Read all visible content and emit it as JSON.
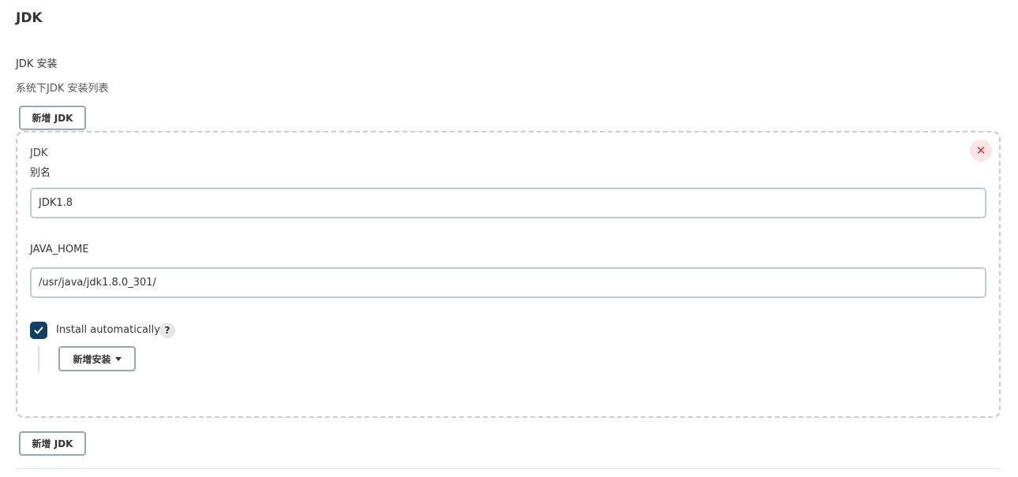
{
  "page": {
    "title": "JDK"
  },
  "section": {
    "label": "JDK 安装",
    "description": "系统下JDK 安装列表"
  },
  "buttons": {
    "add_jdk_top": "新增 JDK",
    "add_jdk_bottom": "新增 JDK"
  },
  "jdk_card": {
    "header": "JDK",
    "alias_label": "别名",
    "alias_value": "JDK1.8",
    "java_home_label": "JAVA_HOME",
    "java_home_value": "/usr/java/jdk1.8.0_301/",
    "install_auto_label": "Install automatically",
    "install_auto_checked": true,
    "help_glyph": "?",
    "close_glyph": "✕",
    "add_installer_label": "新增安装"
  },
  "icons": {
    "close": "close-icon",
    "check": "check-icon",
    "help": "help-icon",
    "caret": "caret-down-icon"
  },
  "colors": {
    "checkbox": "#123f63",
    "close_bg": "#fbe5e7",
    "close_fg": "#d32f3c"
  }
}
